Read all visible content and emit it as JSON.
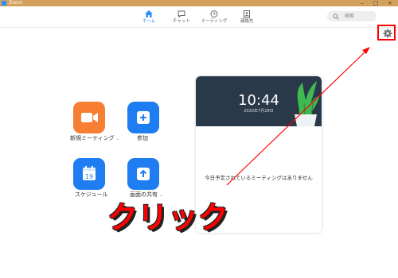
{
  "window": {
    "title": "Zoom",
    "minimize": "–",
    "maximize": "□",
    "close": "×"
  },
  "nav": {
    "tabs": [
      {
        "label": "ホーム",
        "icon": "home-icon",
        "active": true
      },
      {
        "label": "チャット",
        "icon": "chat-icon",
        "active": false
      },
      {
        "label": "ミーティング",
        "icon": "clock-icon",
        "active": false
      },
      {
        "label": "連絡先",
        "icon": "contacts-icon",
        "active": false
      }
    ],
    "search_placeholder": "検索"
  },
  "actions": [
    {
      "label": "新規ミーティング",
      "icon": "video-camera-icon",
      "color": "#f77e32",
      "dropdown": true
    },
    {
      "label": "参加",
      "icon": "plus-icon",
      "color": "#1e7df0",
      "dropdown": false
    },
    {
      "label": "スケジュール",
      "icon": "calendar-icon",
      "color": "#1e7df0",
      "dropdown": false,
      "calendar_day": "19"
    },
    {
      "label": "画面の共有",
      "icon": "share-screen-icon",
      "color": "#1e7df0",
      "dropdown": true
    }
  ],
  "card": {
    "time": "10:44",
    "date": "2020年7月28日",
    "empty_message": "今日予定されているミーティングはありません"
  },
  "annotation": {
    "callout": "クリック",
    "color": "#ff0000"
  },
  "colors": {
    "accent": "#2d8cff",
    "titlebar": "#d4a15c",
    "banner": "#29394a"
  }
}
